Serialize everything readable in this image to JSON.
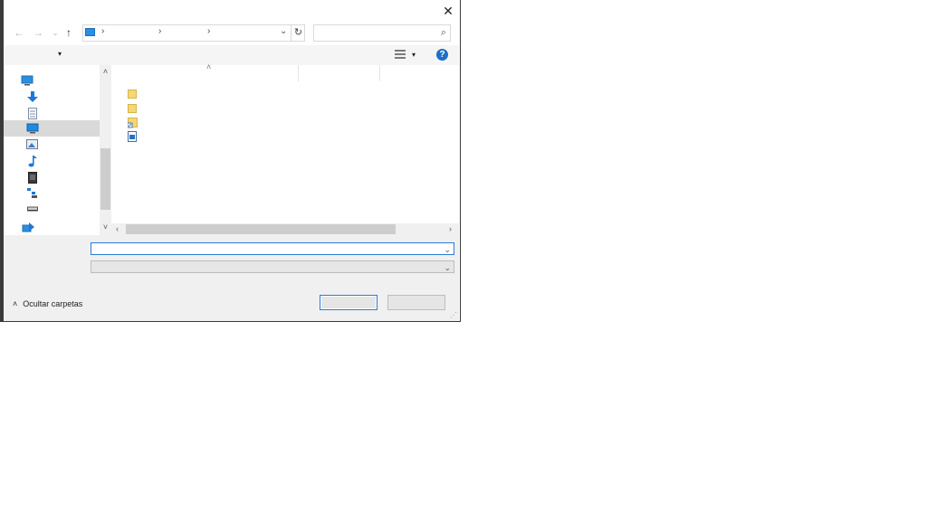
{
  "dialog": {
    "close_glyph": "✕",
    "nav": {
      "back": "←",
      "forward": "→",
      "recent": "⌄",
      "up": "↑"
    },
    "address": {
      "sep1": "›",
      "sep2": "›",
      "sep3": "›",
      "dropdown": "⌄",
      "refresh": "↻"
    },
    "search": {
      "value": "",
      "icon": "search-icon"
    },
    "toolbar": {
      "organize_dropdown": "▾",
      "view_dropdown": "▾",
      "help": "?"
    },
    "nav_pane": {
      "items": [
        {
          "icon": "this-pc-icon"
        },
        {
          "icon": "downloads-icon"
        },
        {
          "icon": "documents-icon"
        },
        {
          "icon": "desktop-icon",
          "selected": true
        },
        {
          "icon": "pictures-icon"
        },
        {
          "icon": "music-icon"
        },
        {
          "icon": "videos-icon"
        },
        {
          "icon": "network-tree-icon"
        },
        {
          "icon": "drive-icon"
        },
        {
          "icon": "network-icon"
        }
      ],
      "scroll_up": "˄",
      "scroll_down": "˅"
    },
    "content": {
      "sort_caret": "˄",
      "files": [
        {
          "icon": "folder-icon"
        },
        {
          "icon": "folder-icon"
        },
        {
          "icon": "folder-shortcut-icon"
        },
        {
          "icon": "file-icon"
        }
      ],
      "scroll_left": "‹",
      "scroll_right": "›"
    },
    "file_name": {
      "value": "",
      "chevron": "⌄"
    },
    "file_type": {
      "value": "",
      "chevron": "⌄"
    },
    "hide_folders": {
      "caret": "˄",
      "label": "Ocultar carpetas"
    },
    "open_button": "",
    "cancel_button": "",
    "colors": {
      "accent": "#2a7bd6",
      "selection": "#d9d9d9",
      "help": "#1e6fc8"
    }
  }
}
